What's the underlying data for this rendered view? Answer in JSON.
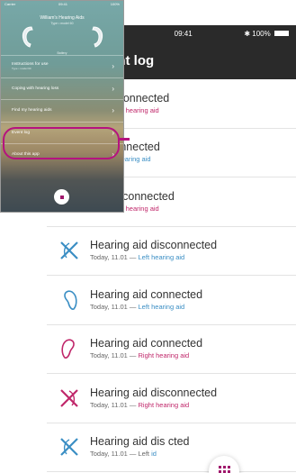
{
  "back": {
    "status": {
      "time": "09:41",
      "battery": "100%"
    },
    "nav_title": "ent log",
    "items": [
      {
        "title": "g aid connected",
        "date": "17 — ",
        "side": "Right hearing aid",
        "side_class": "right",
        "icon": "hearing-aid-right-icon"
      },
      {
        "title": "aid connected",
        "date": "7 — ",
        "side": "Left hearing aid",
        "side_class": "left",
        "icon": "hearing-aid-left-icon"
      },
      {
        "title": "aid disconnected",
        "date": "01 — ",
        "side": "Right hearing aid",
        "side_class": "right",
        "icon": "hearing-aid-disconnected-icon"
      },
      {
        "title": "Hearing aid disconnected",
        "date": "Today, 11.01 — ",
        "side": "Left hearing aid",
        "side_class": "left",
        "icon": "hearing-aid-disconnected-left-icon"
      },
      {
        "title": "Hearing aid connected",
        "date": "Today, 11.01 — ",
        "side": "Left hearing aid",
        "side_class": "left",
        "icon": "hearing-aid-left-icon"
      },
      {
        "title": "Hearing aid connected",
        "date": "Today, 11.01 — ",
        "side": "Right hearing aid",
        "side_class": "right",
        "icon": "hearing-aid-right-icon"
      },
      {
        "title": "Hearing aid disconnected",
        "date": "Today, 11.01 — ",
        "side": "Right hearing aid",
        "side_class": "right",
        "icon": "hearing-aid-disconnected-right-icon"
      },
      {
        "title": "Hearing aid dis        cted",
        "date": "Today, 11.01 — Left",
        "side": "   id",
        "side_class": "left",
        "icon": "hearing-aid-disconnected-left-icon"
      }
    ]
  },
  "front": {
    "status": {
      "carrier": "Carrier",
      "time": "09:41",
      "battery": "100%"
    },
    "title": "William's Hearing Aids",
    "subtitle": "Type • model 60",
    "battery_label": "Battery",
    "menu": [
      {
        "label": "Instructions for use",
        "sub": "Type • model 60"
      },
      {
        "label": "Coping with hearing loss",
        "sub": ""
      },
      {
        "label": "Find my hearing aids",
        "sub": ""
      },
      {
        "label": "Event log",
        "sub": ""
      },
      {
        "label": "About this app",
        "sub": ""
      }
    ]
  },
  "colors": {
    "accent": "#b5137f",
    "right_side": "#c0276a",
    "left_side": "#3a8ec4",
    "nav_bg": "#2a2a2a"
  }
}
